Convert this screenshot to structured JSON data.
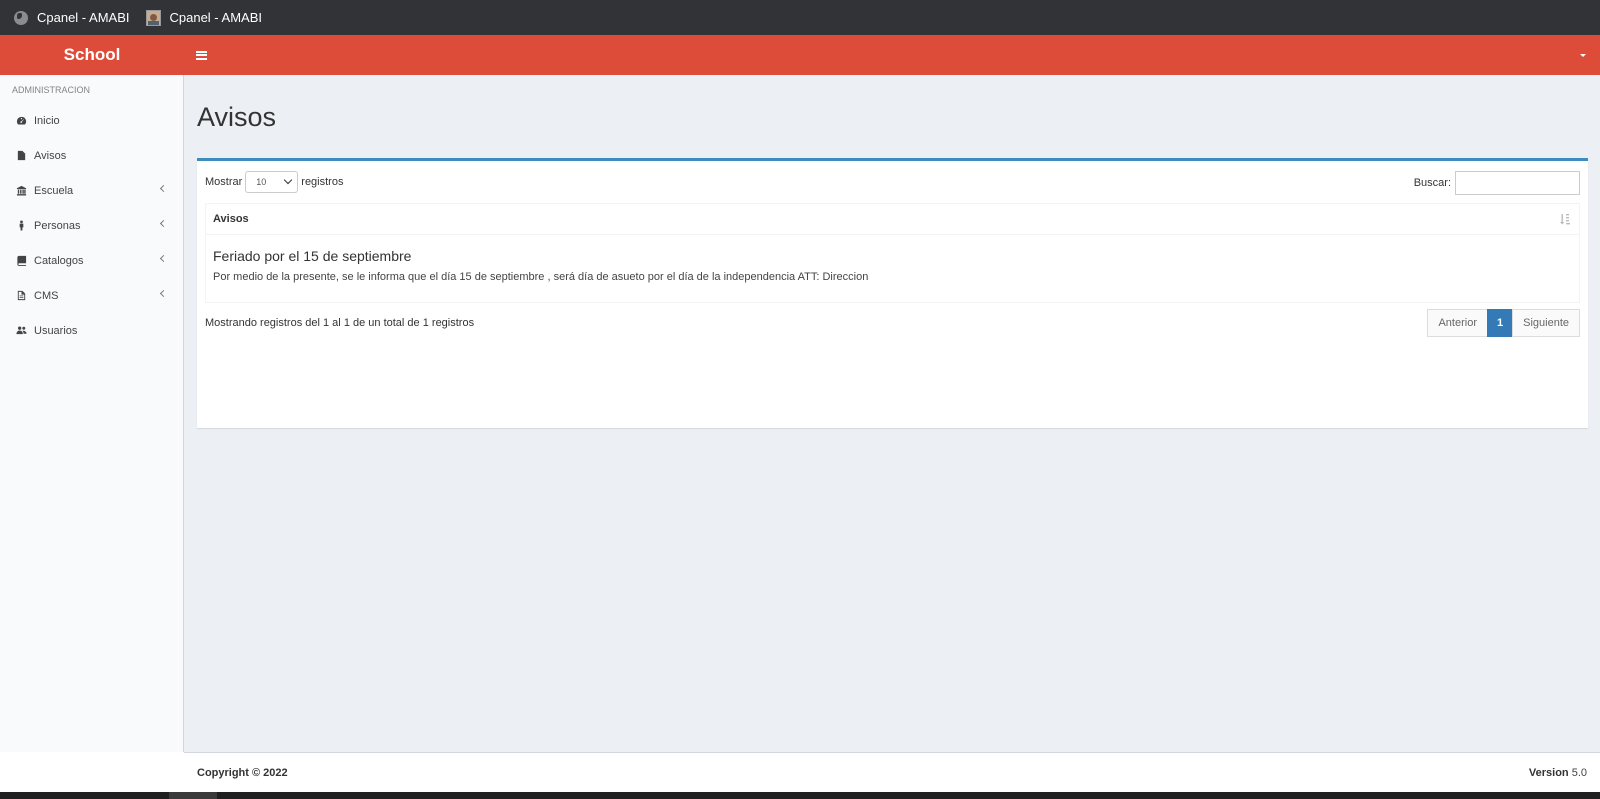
{
  "browser": {
    "tabs": [
      {
        "label": "Cpanel - AMABI",
        "icon": "globe-icon"
      },
      {
        "label": "Cpanel - AMABI",
        "icon": "avatar-icon"
      }
    ]
  },
  "navbar": {
    "brand": "School",
    "toggle_icon": "hamburger-icon",
    "user_icon": "caret-down-icon",
    "color": "#dd4b39"
  },
  "sidebar": {
    "header": "ADMINISTRACION",
    "items": [
      {
        "label": "Inicio",
        "icon": "dashboard-icon"
      },
      {
        "label": "Avisos",
        "icon": "file-icon"
      },
      {
        "label": "Escuela",
        "icon": "bank-icon"
      },
      {
        "label": "Personas",
        "icon": "person-icon"
      },
      {
        "label": "Catalogos",
        "icon": "book-icon"
      },
      {
        "label": "CMS",
        "icon": "file-text-icon"
      },
      {
        "label": "Usuarios",
        "icon": "users-icon"
      }
    ]
  },
  "main": {
    "title": "Avisos",
    "length": {
      "prefix": "Mostrar",
      "value": "10",
      "suffix": "registros"
    },
    "search": {
      "label": "Buscar:",
      "value": ""
    },
    "table": {
      "header": "Avisos",
      "rows": [
        {
          "title": "Feriado por el 15 de septiembre",
          "text": "Por medio de la presente, se le informa que el día 15 de septiembre , será día de asueto por el día de la independencia ATT: Direccion"
        }
      ]
    },
    "info": {
      "a": "Mostrando registros del ",
      "b": "1",
      "c": " al ",
      "d": "1",
      "e": " de un total de ",
      "f": "1",
      "g": " registros"
    },
    "pagination": {
      "prev": "Anterior",
      "current": "1",
      "next": "Siguiente"
    },
    "accent": "#3c8dbc"
  },
  "footer": {
    "copyright": "Copyright © 2022",
    "version_label": "Version",
    "version": "5.0"
  }
}
